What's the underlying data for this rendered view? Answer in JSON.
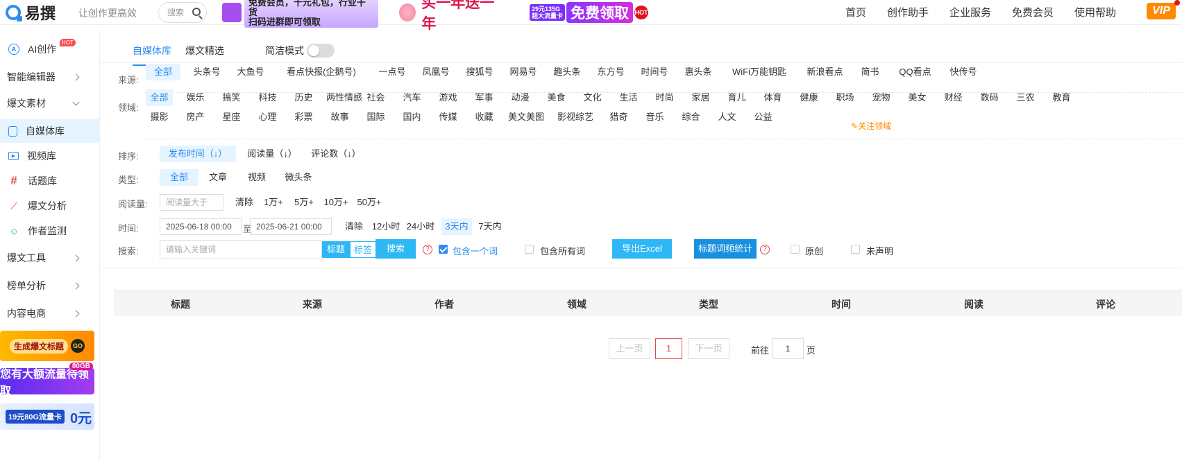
{
  "header": {
    "logo_text": "易撰",
    "slogan": "让创作更高效",
    "search_placeholder": "搜索",
    "banner1_line1": "免费会员，千元礼包，行业干货",
    "banner1_line2": "扫码进群即可领取",
    "banner2": "买一年送一年",
    "banner3_card1": "29元135G",
    "banner3_card2": "超大流量卡",
    "banner3_main": "免费领取",
    "banner3_hot": "HOT",
    "nav": [
      "首页",
      "创作助手",
      "企业服务",
      "免费会员",
      "使用帮助"
    ],
    "vip": "VIP"
  },
  "sidebar": {
    "ai_create": "AI创作",
    "hot": "HOT",
    "editor": "智能编辑器",
    "material": "爆文素材",
    "sub": [
      "自媒体库",
      "视频库",
      "话题库",
      "爆文分析",
      "作者监测"
    ],
    "tools": "爆文工具",
    "rank": "榜单分析",
    "ecommerce": "内容电商",
    "promo1": "生成爆文标题",
    "promo1_go": "GO",
    "promo2_tag": "80GB",
    "promo2": "您有大额流量待领取",
    "promo3": "19元80G流量卡",
    "promo3_zero": "0元"
  },
  "tabs": {
    "tab1": "自媒体库",
    "tab2": "爆文精选",
    "simple_mode": "简洁模式"
  },
  "filters": {
    "source_label": "来源:",
    "sources": [
      "全部",
      "头条号",
      "大鱼号",
      "看点快报(企鹅号)",
      "一点号",
      "凤凰号",
      "搜狐号",
      "网易号",
      "趣头条",
      "东方号",
      "时间号",
      "惠头条",
      "WiFi万能钥匙",
      "新浪看点",
      "简书",
      "QQ看点",
      "快传号"
    ],
    "domain_label": "领域:",
    "domains_row1": [
      "全部",
      "娱乐",
      "搞笑",
      "科技",
      "历史",
      "两性情感",
      "社会",
      "汽车",
      "游戏",
      "军事",
      "动漫",
      "美食",
      "文化",
      "生活",
      "时尚",
      "家居",
      "育儿",
      "体育",
      "健康",
      "职场",
      "宠物",
      "美女",
      "财经",
      "数码",
      "三农",
      "教育"
    ],
    "domains_row2": [
      "摄影",
      "房产",
      "星座",
      "心理",
      "彩票",
      "故事",
      "国际",
      "国内",
      "传媒",
      "收藏",
      "美文美图",
      "影视综艺",
      "猎奇",
      "音乐",
      "综合",
      "人文",
      "公益"
    ],
    "follow_domain": "关注领域",
    "sort_label": "排序:",
    "sorts": [
      "发布时间（↓）",
      "阅读量（↓）",
      "评论数（↓）"
    ],
    "type_label": "类型:",
    "types": [
      "全部",
      "文章",
      "视频",
      "微头条"
    ],
    "read_label": "阅读量:",
    "read_placeholder": "阅读量大于",
    "read_opts": [
      "清除",
      "1万+",
      "5万+",
      "10万+",
      "50万+"
    ],
    "time_label": "时间:",
    "date_start": "2025-06-18 00:00",
    "date_to": "至",
    "date_end": "2025-06-21 00:00",
    "time_opts": [
      "清除",
      "12小时",
      "24小时",
      "3天内",
      "7天内"
    ],
    "search_label": "搜索:",
    "search_placeholder": "请输入关键词",
    "search_title": "标题",
    "search_tag": "标签",
    "search_btn": "搜索",
    "include_one": "包含一个词",
    "include_all": "包含所有词",
    "export_btn": "导出Excel",
    "freq_btn": "标题词频统计",
    "original": "原创",
    "undeclared": "未声明"
  },
  "table": {
    "headers": [
      "标题",
      "来源",
      "作者",
      "领域",
      "类型",
      "时间",
      "阅读",
      "评论"
    ]
  },
  "pager": {
    "prev": "上一页",
    "current": "1",
    "next": "下一页",
    "goto": "前往",
    "page_value": "1",
    "page_unit": "页"
  },
  "colors": {
    "accent": "#2d8cf0",
    "button": "#2db7f5",
    "active_bg": "#e6f4ff",
    "pager_current": "#e64545"
  }
}
